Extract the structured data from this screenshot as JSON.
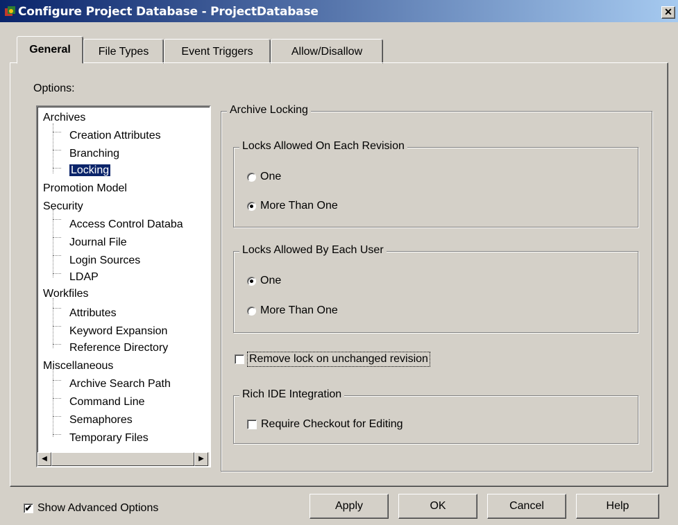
{
  "window": {
    "title": "Configure Project Database - ProjectDatabase",
    "close_glyph": "✕"
  },
  "tabs": [
    {
      "label": "General",
      "active": true
    },
    {
      "label": "File Types",
      "active": false
    },
    {
      "label": "Event Triggers",
      "active": false
    },
    {
      "label": "Allow/Disallow",
      "active": false
    }
  ],
  "options_label": "Options:",
  "tree": {
    "items": [
      {
        "label": "Archives",
        "level": 0
      },
      {
        "label": "Creation Attributes",
        "level": 1
      },
      {
        "label": "Branching",
        "level": 1
      },
      {
        "label": "Locking",
        "level": 1,
        "selected": true
      },
      {
        "label": "Promotion Model",
        "level": 0
      },
      {
        "label": "Security",
        "level": 0
      },
      {
        "label": "Access Control Databa",
        "level": 1
      },
      {
        "label": "Journal File",
        "level": 1
      },
      {
        "label": "Login Sources",
        "level": 1
      },
      {
        "label": "LDAP",
        "level": 1
      },
      {
        "label": "Workfiles",
        "level": 0
      },
      {
        "label": "Attributes",
        "level": 1
      },
      {
        "label": "Keyword Expansion",
        "level": 1
      },
      {
        "label": "Reference Directory",
        "level": 1
      },
      {
        "label": "Miscellaneous",
        "level": 0
      },
      {
        "label": "Archive Search Path",
        "level": 1
      },
      {
        "label": "Command Line",
        "level": 1
      },
      {
        "label": "Semaphores",
        "level": 1
      },
      {
        "label": "Temporary Files",
        "level": 1
      }
    ],
    "scroll_left": "◀",
    "scroll_right": "▶"
  },
  "archive_locking": {
    "title": "Archive Locking",
    "per_revision": {
      "title": "Locks Allowed On Each Revision",
      "options": [
        {
          "label": "One",
          "selected": false
        },
        {
          "label": "More Than One",
          "selected": true
        }
      ]
    },
    "per_user": {
      "title": "Locks Allowed By Each User",
      "options": [
        {
          "label": "One",
          "selected": true
        },
        {
          "label": "More Than One",
          "selected": false
        }
      ]
    },
    "remove_lock": {
      "label": "Remove lock on unchanged revision",
      "checked": false
    },
    "rich_ide": {
      "title": "Rich IDE Integration",
      "require_checkout": {
        "label": "Require Checkout for Editing",
        "checked": false
      }
    }
  },
  "footer": {
    "show_advanced": {
      "label": "Show Advanced Options",
      "checked": true,
      "mark": "✔"
    },
    "buttons": {
      "apply": "Apply",
      "ok": "OK",
      "cancel": "Cancel",
      "help": "Help"
    }
  },
  "colors": {
    "face": "#d4d0c8",
    "title_start": "#0a246a",
    "title_end": "#a6caf0",
    "selection": "#0a246a"
  }
}
